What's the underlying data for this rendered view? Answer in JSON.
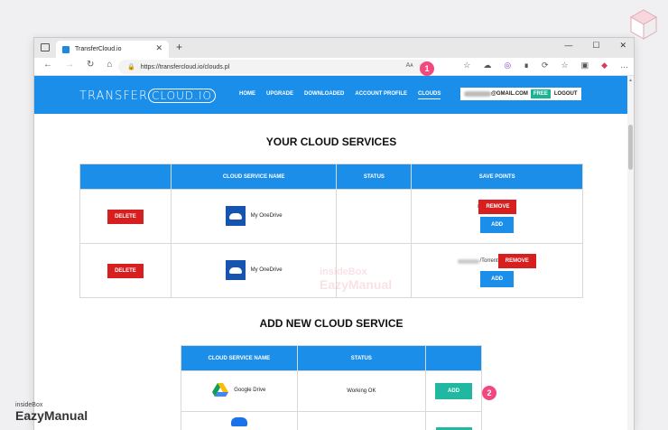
{
  "browser": {
    "tab_title": "TransferCloud.io",
    "new_tab": "+",
    "url": "https://transfercloud.io/clouds.pl",
    "nav": {
      "back": "←",
      "forward": "→",
      "reload": "↻",
      "home": "⌂"
    },
    "window_controls": [
      "—",
      "☐",
      "✕"
    ],
    "url_icons": [
      "Aᴀ",
      "☆"
    ],
    "toolbar_icons": [
      "☆",
      "⌂",
      "◎",
      "∎",
      "⟳",
      "☆",
      "▣",
      "◆",
      "…"
    ]
  },
  "site": {
    "logo_left": "TRANSFER",
    "logo_box": "CLOUD.IO",
    "menu": [
      {
        "label": "HOME"
      },
      {
        "label": "UPGRADE"
      },
      {
        "label": "DOWNLOADED"
      },
      {
        "label": "ACCOUNT PROFILE"
      },
      {
        "label": "CLOUDS"
      }
    ],
    "account_email": "@GMAIL.COM",
    "plan": "FREE",
    "logout": "LOGOUT"
  },
  "your_clouds": {
    "title": "YOUR CLOUD SERVICES",
    "headers": [
      "",
      "CLOUD SERVICE NAME",
      "STATUS",
      "SAVE POINTS"
    ],
    "rows": [
      {
        "delete": "DELETE",
        "service": "My OneDrive",
        "status": "",
        "path": "/",
        "remove": "REMOVE",
        "add": "ADD"
      },
      {
        "delete": "DELETE",
        "service": "My OneDrive",
        "status": "",
        "path": "/Torrent",
        "remove": "REMOVE",
        "add": "ADD"
      }
    ]
  },
  "add_new": {
    "title": "ADD NEW CLOUD SERVICE",
    "headers": [
      "CLOUD SERVICE NAME",
      "STATUS",
      ""
    ],
    "rows": [
      {
        "service": "Google Drive",
        "status": "Working OK",
        "add": "ADD"
      }
    ]
  },
  "badges": [
    "1",
    "2"
  ],
  "watermark": {
    "small": "insideBox",
    "big": "EazyManual"
  },
  "center_watermark": {
    "line1": "insideBox",
    "line2": "EazyManual"
  },
  "colors": {
    "brand_blue": "#1b8eea",
    "delete_red": "#d71f1f",
    "add_teal": "#20b8a1",
    "badge_pink": "#f2487d"
  }
}
